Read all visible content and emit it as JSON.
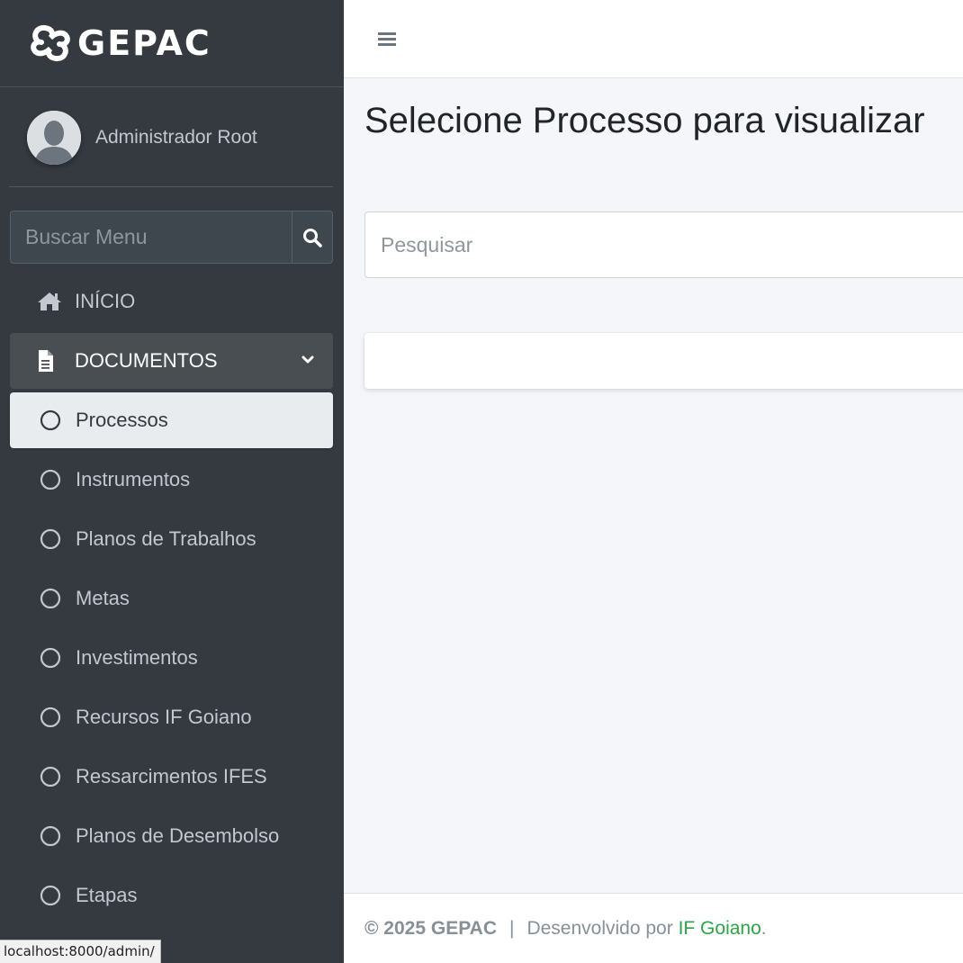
{
  "brand": {
    "name": "GEPAC"
  },
  "user": {
    "name": "Administrador Root"
  },
  "sidebar_search": {
    "placeholder": "Buscar Menu",
    "icon": "search-icon"
  },
  "nav": {
    "home": {
      "label": "INÍCIO",
      "icon": "home-icon"
    },
    "documents": {
      "label": "DOCUMENTOS",
      "icon": "file-icon"
    },
    "sub_items": [
      {
        "label": "Processos",
        "active": true
      },
      {
        "label": "Instrumentos"
      },
      {
        "label": "Planos de Trabalhos"
      },
      {
        "label": "Metas"
      },
      {
        "label": "Investimentos"
      },
      {
        "label": "Recursos IF Goiano"
      },
      {
        "label": "Ressarcimentos IFES"
      },
      {
        "label": "Planos de Desembolso"
      },
      {
        "label": "Etapas"
      }
    ]
  },
  "main": {
    "title": "Selecione Processo para visualizar",
    "search_placeholder": "Pesquisar"
  },
  "footer": {
    "copyright": "© 2025 GEPAC",
    "separator": "|",
    "developed_by": "Desenvolvido por",
    "link_text": "IF Goiano",
    "end": "."
  },
  "status_url": "localhost:8000/admin/",
  "colors": {
    "sidebar": "#343a40",
    "active_bg": "#e9ecef",
    "link": "#28a745"
  }
}
